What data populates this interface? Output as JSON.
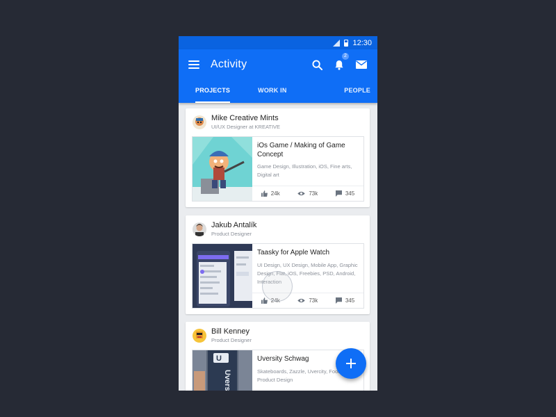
{
  "status": {
    "time": "12:30"
  },
  "header": {
    "title": "Activity",
    "notification_count": "2"
  },
  "tabs": [
    {
      "label": "PROJECTS",
      "active": true
    },
    {
      "label": "WORK IN PROGRESS",
      "active": false
    },
    {
      "label": "PEOPLE",
      "active": false
    }
  ],
  "cards": [
    {
      "name": "Mike Creative Mints",
      "role": "UI/UX Designer at KREATIVE",
      "project_title": "iOs Game / Making of Game Concept",
      "tags": "Game Design, Illustration, iOS, Fine arts, Digital art",
      "likes": "24k",
      "views": "73k",
      "comments": "345"
    },
    {
      "name": "Jakub Antalík",
      "role": "Product Designer",
      "project_title": "Taasky for Apple Watch",
      "tags": "UI Design, UX Design, Mobile App, Graphic Design, Flat, iOS, Freebies, PSD, Android, Interaction",
      "likes": "24k",
      "views": "73k",
      "comments": "345"
    },
    {
      "name": "Bill Kenney",
      "role": "Product Designer",
      "project_title": "Uversity Schwag",
      "tags": "Skateboards, Zazzle, Uvercity, Food, Product Design",
      "likes": "",
      "views": "",
      "comments": ""
    }
  ],
  "colors": {
    "primary": "#0f6ef6",
    "status_bar": "#0a63e0",
    "background": "#262a35"
  },
  "icons": [
    "menu-icon",
    "search-icon",
    "bell-icon",
    "mail-icon",
    "thumbs-up-icon",
    "eye-icon",
    "comment-icon",
    "plus-icon"
  ]
}
